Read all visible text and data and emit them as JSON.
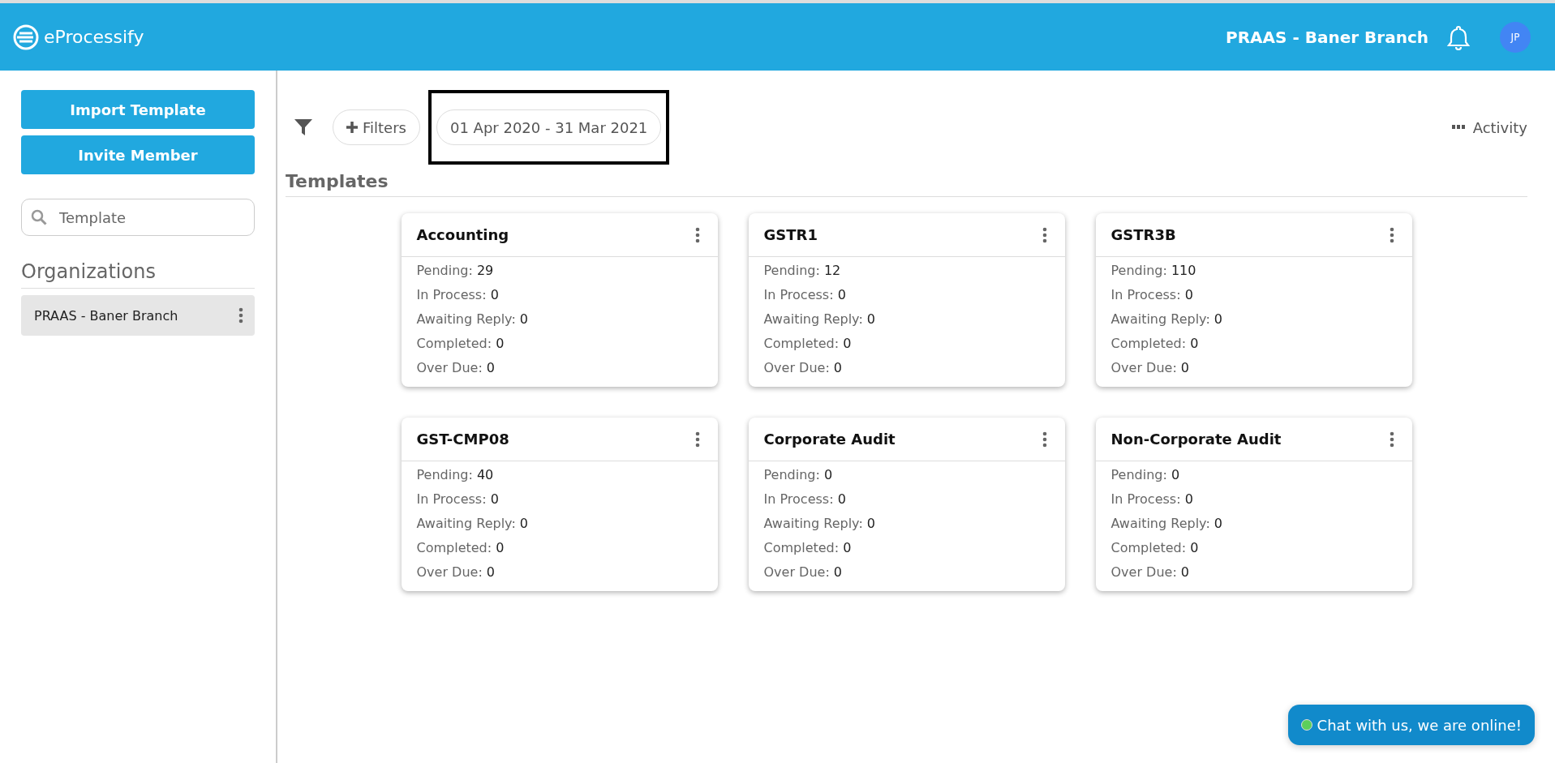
{
  "header": {
    "logo": "eProcessify",
    "branch": "PRAAS - Baner Branch",
    "avatar": "JP"
  },
  "sidebar": {
    "buttons": [
      "Import Template",
      "Invite Member"
    ],
    "search": {
      "placeholder": "Template"
    },
    "section_title": "Organizations",
    "organizations": [
      {
        "name": "PRAAS - Baner Branch",
        "selected": true
      }
    ]
  },
  "toolbar": {
    "filters": "Filters",
    "date_range": "01 Apr 2020 - 31 Mar 2021",
    "activity": "Activity"
  },
  "templates_title": "Templates",
  "templates": [
    {
      "title": "Accounting",
      "stats": [
        {
          "label": "Pending:",
          "value": "29"
        },
        {
          "label": "In Process:",
          "value": "0"
        },
        {
          "label": "Awaiting Reply:",
          "value": "0"
        },
        {
          "label": "Completed:",
          "value": "0"
        },
        {
          "label": "Over Due:",
          "value": "0"
        }
      ]
    },
    {
      "title": "GSTR1",
      "stats": [
        {
          "label": "Pending:",
          "value": "12"
        },
        {
          "label": "In Process:",
          "value": "0"
        },
        {
          "label": "Awaiting Reply:",
          "value": "0"
        },
        {
          "label": "Completed:",
          "value": "0"
        },
        {
          "label": "Over Due:",
          "value": "0"
        }
      ]
    },
    {
      "title": "GSTR3B",
      "stats": [
        {
          "label": "Pending:",
          "value": "110"
        },
        {
          "label": "In Process:",
          "value": "0"
        },
        {
          "label": "Awaiting Reply:",
          "value": "0"
        },
        {
          "label": "Completed:",
          "value": "0"
        },
        {
          "label": "Over Due:",
          "value": "0"
        }
      ]
    },
    {
      "title": "GST-CMP08",
      "stats": [
        {
          "label": "Pending:",
          "value": "40"
        },
        {
          "label": "In Process:",
          "value": "0"
        },
        {
          "label": "Awaiting Reply:",
          "value": "0"
        },
        {
          "label": "Completed:",
          "value": "0"
        },
        {
          "label": "Over Due:",
          "value": "0"
        }
      ]
    },
    {
      "title": "Corporate Audit",
      "stats": [
        {
          "label": "Pending:",
          "value": "0"
        },
        {
          "label": "In Process:",
          "value": "0"
        },
        {
          "label": "Awaiting Reply:",
          "value": "0"
        },
        {
          "label": "Completed:",
          "value": "0"
        },
        {
          "label": "Over Due:",
          "value": "0"
        }
      ]
    },
    {
      "title": "Non-Corporate Audit",
      "stats": [
        {
          "label": "Pending:",
          "value": "0"
        },
        {
          "label": "In Process:",
          "value": "0"
        },
        {
          "label": "Awaiting Reply:",
          "value": "0"
        },
        {
          "label": "Completed:",
          "value": "0"
        },
        {
          "label": "Over Due:",
          "value": "0"
        }
      ]
    }
  ],
  "chat": {
    "text": "Chat with us, we are online!",
    "online": true
  }
}
